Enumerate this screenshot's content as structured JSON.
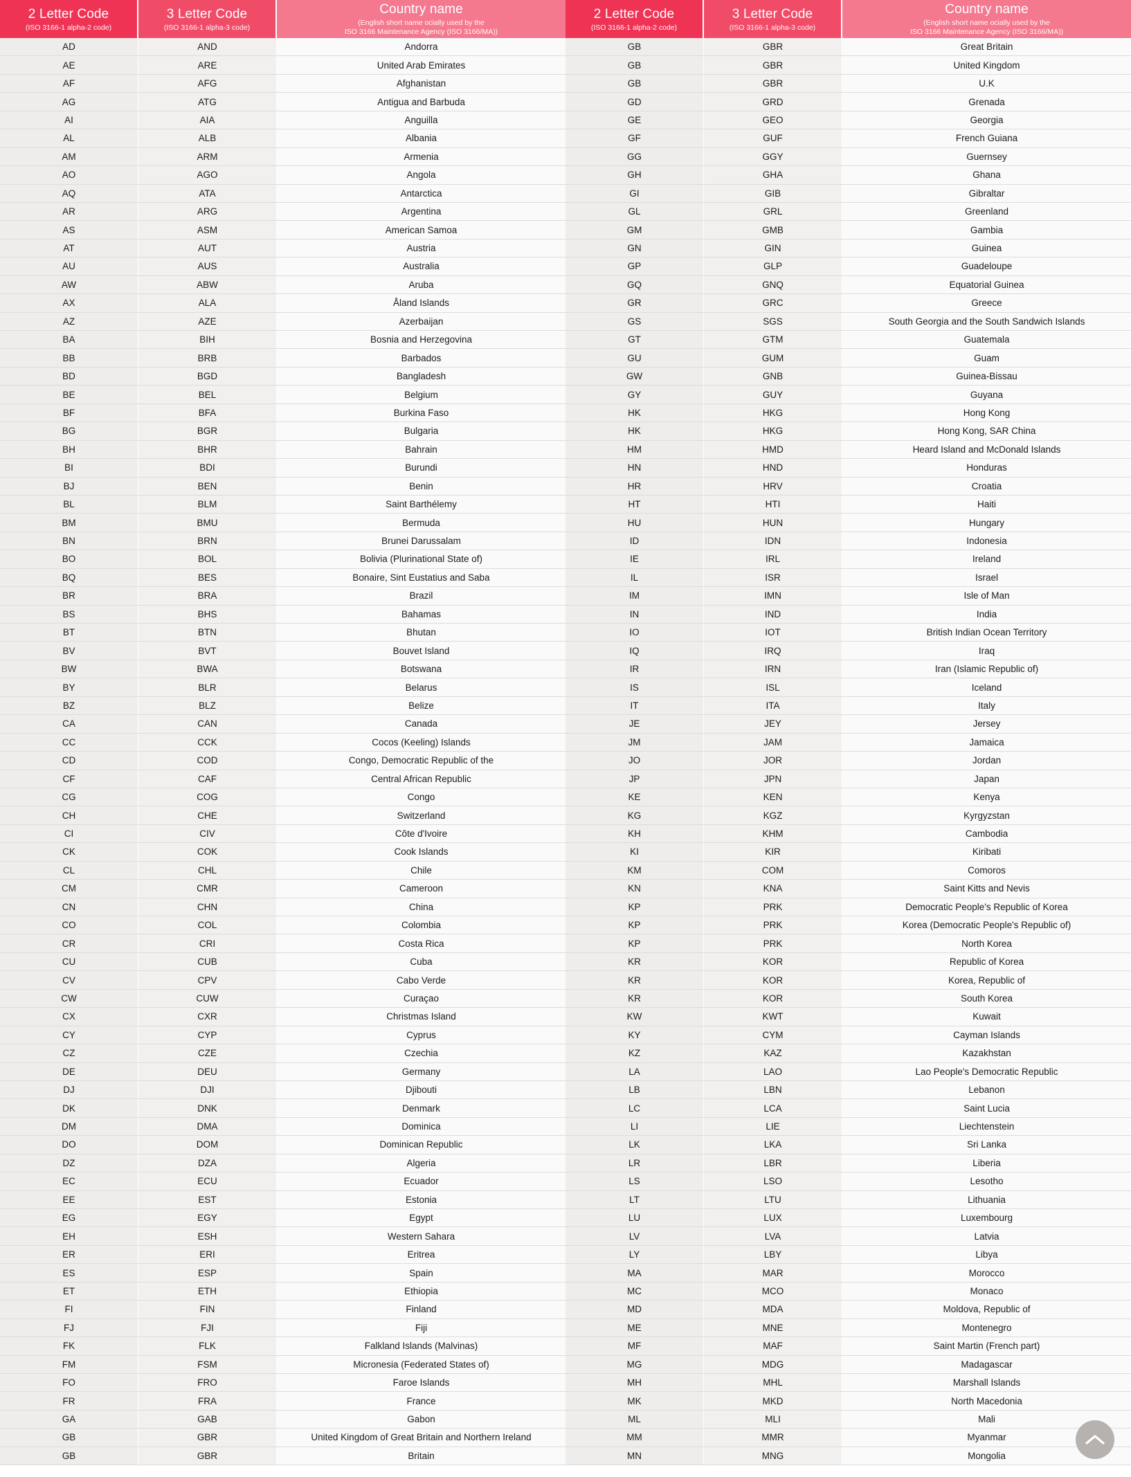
{
  "table": {
    "columns": [
      {
        "id": "alpha2",
        "title": "2 Letter Code",
        "subtitle": "(ISO 3166-1 alpha-2 code)",
        "header_bg": "#ef3355"
      },
      {
        "id": "alpha3",
        "title": "3 Letter Code",
        "subtitle": "(ISO 3166-1 alpha-3 code)",
        "header_bg": "#f04c68"
      },
      {
        "id": "name",
        "title": "Country name",
        "subtitle": "(English short name ocially used by the ISO 3166 Maintenance Agency (ISO 3166/MA))",
        "subtitle_line1": "(English short name ocially used by the",
        "subtitle_line2": "ISO 3166 Maintenance Agency (ISO 3166/MA))",
        "header_bg": "#f4798f"
      }
    ],
    "left_rows": [
      {
        "a2": "AD",
        "a3": "AND",
        "name": "Andorra"
      },
      {
        "a2": "AE",
        "a3": "ARE",
        "name": "United Arab Emirates"
      },
      {
        "a2": "AF",
        "a3": "AFG",
        "name": "Afghanistan"
      },
      {
        "a2": "AG",
        "a3": "ATG",
        "name": "Antigua and Barbuda"
      },
      {
        "a2": "AI",
        "a3": "AIA",
        "name": "Anguilla"
      },
      {
        "a2": "AL",
        "a3": "ALB",
        "name": "Albania"
      },
      {
        "a2": "AM",
        "a3": "ARM",
        "name": "Armenia"
      },
      {
        "a2": "AO",
        "a3": "AGO",
        "name": "Angola"
      },
      {
        "a2": "AQ",
        "a3": "ATA",
        "name": "Antarctica"
      },
      {
        "a2": "AR",
        "a3": "ARG",
        "name": "Argentina"
      },
      {
        "a2": "AS",
        "a3": "ASM",
        "name": "American Samoa"
      },
      {
        "a2": "AT",
        "a3": "AUT",
        "name": "Austria"
      },
      {
        "a2": "AU",
        "a3": "AUS",
        "name": "Australia"
      },
      {
        "a2": "AW",
        "a3": "ABW",
        "name": "Aruba"
      },
      {
        "a2": "AX",
        "a3": "ALA",
        "name": "Åland Islands"
      },
      {
        "a2": "AZ",
        "a3": "AZE",
        "name": "Azerbaijan"
      },
      {
        "a2": "BA",
        "a3": "BIH",
        "name": "Bosnia and Herzegovina"
      },
      {
        "a2": "BB",
        "a3": "BRB",
        "name": "Barbados"
      },
      {
        "a2": "BD",
        "a3": "BGD",
        "name": "Bangladesh"
      },
      {
        "a2": "BE",
        "a3": "BEL",
        "name": "Belgium"
      },
      {
        "a2": "BF",
        "a3": "BFA",
        "name": "Burkina Faso"
      },
      {
        "a2": "BG",
        "a3": "BGR",
        "name": "Bulgaria"
      },
      {
        "a2": "BH",
        "a3": "BHR",
        "name": "Bahrain"
      },
      {
        "a2": "BI",
        "a3": "BDI",
        "name": "Burundi"
      },
      {
        "a2": "BJ",
        "a3": "BEN",
        "name": "Benin"
      },
      {
        "a2": "BL",
        "a3": "BLM",
        "name": "Saint Barthélemy"
      },
      {
        "a2": "BM",
        "a3": "BMU",
        "name": "Bermuda"
      },
      {
        "a2": "BN",
        "a3": "BRN",
        "name": "Brunei Darussalam"
      },
      {
        "a2": "BO",
        "a3": "BOL",
        "name": "Bolivia (Plurinational State of)"
      },
      {
        "a2": "BQ",
        "a3": "BES",
        "name": "Bonaire, Sint Eustatius and Saba"
      },
      {
        "a2": "BR",
        "a3": "BRA",
        "name": "Brazil"
      },
      {
        "a2": "BS",
        "a3": "BHS",
        "name": "Bahamas"
      },
      {
        "a2": "BT",
        "a3": "BTN",
        "name": "Bhutan"
      },
      {
        "a2": "BV",
        "a3": "BVT",
        "name": "Bouvet Island"
      },
      {
        "a2": "BW",
        "a3": "BWA",
        "name": "Botswana"
      },
      {
        "a2": "BY",
        "a3": "BLR",
        "name": "Belarus"
      },
      {
        "a2": "BZ",
        "a3": "BLZ",
        "name": "Belize"
      },
      {
        "a2": "CA",
        "a3": "CAN",
        "name": "Canada"
      },
      {
        "a2": "CC",
        "a3": "CCK",
        "name": "Cocos (Keeling) Islands"
      },
      {
        "a2": "CD",
        "a3": "COD",
        "name": "Congo, Democratic Republic of the"
      },
      {
        "a2": "CF",
        "a3": "CAF",
        "name": "Central African Republic"
      },
      {
        "a2": "CG",
        "a3": "COG",
        "name": "Congo"
      },
      {
        "a2": "CH",
        "a3": "CHE",
        "name": "Switzerland"
      },
      {
        "a2": "CI",
        "a3": "CIV",
        "name": "Côte d'Ivoire"
      },
      {
        "a2": "CK",
        "a3": "COK",
        "name": "Cook Islands"
      },
      {
        "a2": "CL",
        "a3": "CHL",
        "name": "Chile"
      },
      {
        "a2": "CM",
        "a3": "CMR",
        "name": "Cameroon"
      },
      {
        "a2": "CN",
        "a3": "CHN",
        "name": "China"
      },
      {
        "a2": "CO",
        "a3": "COL",
        "name": "Colombia"
      },
      {
        "a2": "CR",
        "a3": "CRI",
        "name": "Costa Rica"
      },
      {
        "a2": "CU",
        "a3": "CUB",
        "name": "Cuba"
      },
      {
        "a2": "CV",
        "a3": "CPV",
        "name": "Cabo Verde"
      },
      {
        "a2": "CW",
        "a3": "CUW",
        "name": "Curaçao"
      },
      {
        "a2": "CX",
        "a3": "CXR",
        "name": "Christmas Island"
      },
      {
        "a2": "CY",
        "a3": "CYP",
        "name": "Cyprus"
      },
      {
        "a2": "CZ",
        "a3": "CZE",
        "name": "Czechia"
      },
      {
        "a2": "DE",
        "a3": "DEU",
        "name": "Germany"
      },
      {
        "a2": "DJ",
        "a3": "DJI",
        "name": "Djibouti"
      },
      {
        "a2": "DK",
        "a3": "DNK",
        "name": "Denmark"
      },
      {
        "a2": "DM",
        "a3": "DMA",
        "name": "Dominica"
      },
      {
        "a2": "DO",
        "a3": "DOM",
        "name": "Dominican Republic"
      },
      {
        "a2": "DZ",
        "a3": "DZA",
        "name": "Algeria"
      },
      {
        "a2": "EC",
        "a3": "ECU",
        "name": "Ecuador"
      },
      {
        "a2": "EE",
        "a3": "EST",
        "name": "Estonia"
      },
      {
        "a2": "EG",
        "a3": "EGY",
        "name": "Egypt"
      },
      {
        "a2": "EH",
        "a3": "ESH",
        "name": "Western Sahara"
      },
      {
        "a2": "ER",
        "a3": "ERI",
        "name": "Eritrea"
      },
      {
        "a2": "ES",
        "a3": "ESP",
        "name": "Spain"
      },
      {
        "a2": "ET",
        "a3": "ETH",
        "name": "Ethiopia"
      },
      {
        "a2": "FI",
        "a3": "FIN",
        "name": "Finland"
      },
      {
        "a2": "FJ",
        "a3": "FJI",
        "name": "Fiji"
      },
      {
        "a2": "FK",
        "a3": "FLK",
        "name": "Falkland Islands (Malvinas)"
      },
      {
        "a2": "FM",
        "a3": "FSM",
        "name": "Micronesia (Federated States of)"
      },
      {
        "a2": "FO",
        "a3": "FRO",
        "name": "Faroe Islands"
      },
      {
        "a2": "FR",
        "a3": "FRA",
        "name": "France"
      },
      {
        "a2": "GA",
        "a3": "GAB",
        "name": "Gabon"
      },
      {
        "a2": "GB",
        "a3": "GBR",
        "name": "United Kingdom of Great Britain and Northern Ireland"
      },
      {
        "a2": "GB",
        "a3": "GBR",
        "name": "Britain"
      }
    ],
    "right_rows": [
      {
        "a2": "GB",
        "a3": "GBR",
        "name": "Great Britain"
      },
      {
        "a2": "GB",
        "a3": "GBR",
        "name": "United Kingdom"
      },
      {
        "a2": "GB",
        "a3": "GBR",
        "name": "U.K"
      },
      {
        "a2": "GD",
        "a3": "GRD",
        "name": "Grenada"
      },
      {
        "a2": "GE",
        "a3": "GEO",
        "name": "Georgia"
      },
      {
        "a2": "GF",
        "a3": "GUF",
        "name": "French Guiana"
      },
      {
        "a2": "GG",
        "a3": "GGY",
        "name": "Guernsey"
      },
      {
        "a2": "GH",
        "a3": "GHA",
        "name": "Ghana"
      },
      {
        "a2": "GI",
        "a3": "GIB",
        "name": "Gibraltar"
      },
      {
        "a2": "GL",
        "a3": "GRL",
        "name": "Greenland"
      },
      {
        "a2": "GM",
        "a3": "GMB",
        "name": "Gambia"
      },
      {
        "a2": "GN",
        "a3": "GIN",
        "name": "Guinea"
      },
      {
        "a2": "GP",
        "a3": "GLP",
        "name": "Guadeloupe"
      },
      {
        "a2": "GQ",
        "a3": "GNQ",
        "name": "Equatorial Guinea"
      },
      {
        "a2": "GR",
        "a3": "GRC",
        "name": "Greece"
      },
      {
        "a2": "GS",
        "a3": "SGS",
        "name": "South Georgia and the South Sandwich Islands"
      },
      {
        "a2": "GT",
        "a3": "GTM",
        "name": "Guatemala"
      },
      {
        "a2": "GU",
        "a3": "GUM",
        "name": "Guam"
      },
      {
        "a2": "GW",
        "a3": "GNB",
        "name": "Guinea-Bissau"
      },
      {
        "a2": "GY",
        "a3": "GUY",
        "name": "Guyana"
      },
      {
        "a2": "HK",
        "a3": "HKG",
        "name": "Hong Kong"
      },
      {
        "a2": "HK",
        "a3": "HKG",
        "name": "Hong Kong, SAR China"
      },
      {
        "a2": "HM",
        "a3": "HMD",
        "name": "Heard Island and McDonald Islands"
      },
      {
        "a2": "HN",
        "a3": "HND",
        "name": "Honduras"
      },
      {
        "a2": "HR",
        "a3": "HRV",
        "name": "Croatia"
      },
      {
        "a2": "HT",
        "a3": "HTI",
        "name": "Haiti"
      },
      {
        "a2": "HU",
        "a3": "HUN",
        "name": "Hungary"
      },
      {
        "a2": "ID",
        "a3": "IDN",
        "name": "Indonesia"
      },
      {
        "a2": "IE",
        "a3": "IRL",
        "name": "Ireland"
      },
      {
        "a2": "IL",
        "a3": "ISR",
        "name": "Israel"
      },
      {
        "a2": "IM",
        "a3": "IMN",
        "name": "Isle of Man"
      },
      {
        "a2": "IN",
        "a3": "IND",
        "name": "India"
      },
      {
        "a2": "IO",
        "a3": "IOT",
        "name": "British Indian Ocean Territory"
      },
      {
        "a2": "IQ",
        "a3": "IRQ",
        "name": "Iraq"
      },
      {
        "a2": "IR",
        "a3": "IRN",
        "name": "Iran (Islamic Republic of)"
      },
      {
        "a2": "IS",
        "a3": "ISL",
        "name": "Iceland"
      },
      {
        "a2": "IT",
        "a3": "ITA",
        "name": "Italy"
      },
      {
        "a2": "JE",
        "a3": "JEY",
        "name": "Jersey"
      },
      {
        "a2": "JM",
        "a3": "JAM",
        "name": "Jamaica"
      },
      {
        "a2": "JO",
        "a3": "JOR",
        "name": "Jordan"
      },
      {
        "a2": "JP",
        "a3": "JPN",
        "name": "Japan"
      },
      {
        "a2": "KE",
        "a3": "KEN",
        "name": "Kenya"
      },
      {
        "a2": "KG",
        "a3": "KGZ",
        "name": "Kyrgyzstan"
      },
      {
        "a2": "KH",
        "a3": "KHM",
        "name": "Cambodia"
      },
      {
        "a2": "KI",
        "a3": "KIR",
        "name": "Kiribati"
      },
      {
        "a2": "KM",
        "a3": "COM",
        "name": "Comoros"
      },
      {
        "a2": "KN",
        "a3": "KNA",
        "name": "Saint Kitts and Nevis"
      },
      {
        "a2": "KP",
        "a3": "PRK",
        "name": "Democratic People's Republic of Korea"
      },
      {
        "a2": "KP",
        "a3": "PRK",
        "name": "Korea (Democratic People's Republic of)"
      },
      {
        "a2": "KP",
        "a3": "PRK",
        "name": "North Korea"
      },
      {
        "a2": "KR",
        "a3": "KOR",
        "name": "Republic of Korea"
      },
      {
        "a2": "KR",
        "a3": "KOR",
        "name": "Korea, Republic of"
      },
      {
        "a2": "KR",
        "a3": "KOR",
        "name": "South Korea"
      },
      {
        "a2": "KW",
        "a3": "KWT",
        "name": "Kuwait"
      },
      {
        "a2": "KY",
        "a3": "CYM",
        "name": "Cayman Islands"
      },
      {
        "a2": "KZ",
        "a3": "KAZ",
        "name": "Kazakhstan"
      },
      {
        "a2": "LA",
        "a3": "LAO",
        "name": "Lao People's Democratic Republic"
      },
      {
        "a2": "LB",
        "a3": "LBN",
        "name": "Lebanon"
      },
      {
        "a2": "LC",
        "a3": "LCA",
        "name": "Saint Lucia"
      },
      {
        "a2": "LI",
        "a3": "LIE",
        "name": "Liechtenstein"
      },
      {
        "a2": "LK",
        "a3": "LKA",
        "name": "Sri Lanka"
      },
      {
        "a2": "LR",
        "a3": "LBR",
        "name": "Liberia"
      },
      {
        "a2": "LS",
        "a3": "LSO",
        "name": "Lesotho"
      },
      {
        "a2": "LT",
        "a3": "LTU",
        "name": "Lithuania"
      },
      {
        "a2": "LU",
        "a3": "LUX",
        "name": "Luxembourg"
      },
      {
        "a2": "LV",
        "a3": "LVA",
        "name": "Latvia"
      },
      {
        "a2": "LY",
        "a3": "LBY",
        "name": "Libya"
      },
      {
        "a2": "MA",
        "a3": "MAR",
        "name": "Morocco"
      },
      {
        "a2": "MC",
        "a3": "MCO",
        "name": "Monaco"
      },
      {
        "a2": "MD",
        "a3": "MDA",
        "name": "Moldova, Republic of"
      },
      {
        "a2": "ME",
        "a3": "MNE",
        "name": "Montenegro"
      },
      {
        "a2": "MF",
        "a3": "MAF",
        "name": "Saint Martin (French part)"
      },
      {
        "a2": "MG",
        "a3": "MDG",
        "name": "Madagascar"
      },
      {
        "a2": "MH",
        "a3": "MHL",
        "name": "Marshall Islands"
      },
      {
        "a2": "MK",
        "a3": "MKD",
        "name": "North Macedonia"
      },
      {
        "a2": "ML",
        "a3": "MLI",
        "name": "Mali"
      },
      {
        "a2": "MM",
        "a3": "MMR",
        "name": "Myanmar"
      },
      {
        "a2": "MN",
        "a3": "MNG",
        "name": "Mongolia"
      }
    ]
  },
  "scroll_top": {
    "icon": "chevron-up-icon",
    "color": "#b5b2af"
  }
}
